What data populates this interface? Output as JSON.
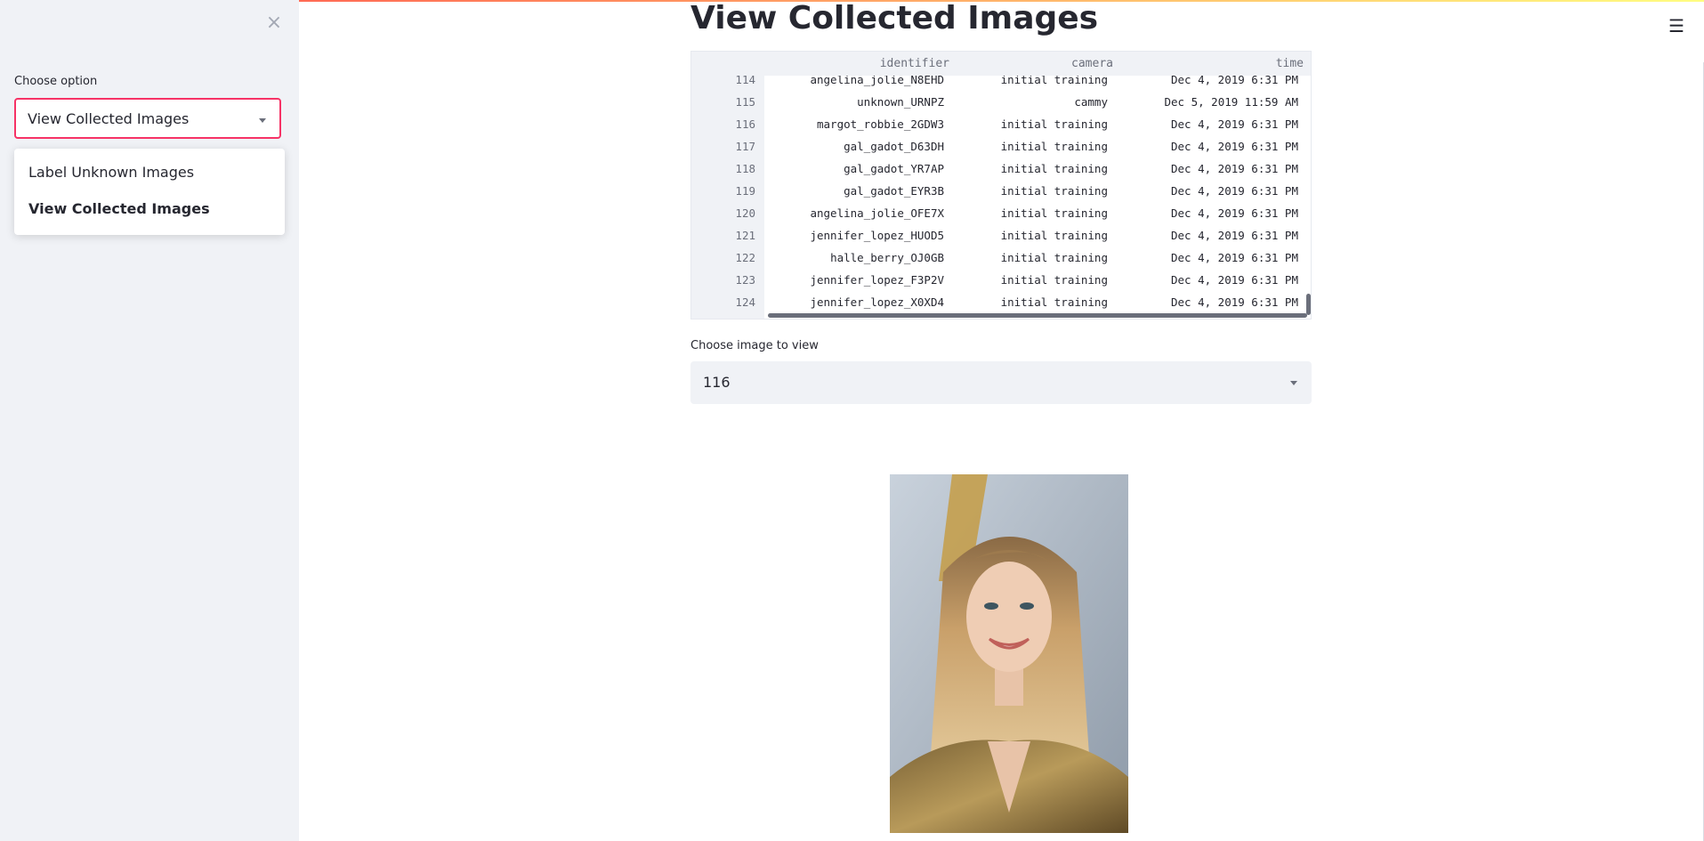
{
  "sidebar": {
    "close_glyph": "×",
    "choose_label": "Choose option",
    "selected": "View Collected Images",
    "options": [
      "Label Unknown Images",
      "View Collected Images"
    ]
  },
  "header": {
    "menu_glyph": "☰"
  },
  "main": {
    "title": "View Collected Images",
    "table": {
      "columns": [
        "identifier",
        "camera",
        "time"
      ],
      "rows": [
        {
          "index": "114",
          "identifier": "angelina_jolie_N8EHD",
          "camera": "initial training",
          "time": "Dec 4, 2019 6:31 PM"
        },
        {
          "index": "115",
          "identifier": "unknown_URNPZ",
          "camera": "cammy",
          "time": "Dec 5, 2019 11:59 AM"
        },
        {
          "index": "116",
          "identifier": "margot_robbie_2GDW3",
          "camera": "initial training",
          "time": "Dec 4, 2019 6:31 PM"
        },
        {
          "index": "117",
          "identifier": "gal_gadot_D63DH",
          "camera": "initial training",
          "time": "Dec 4, 2019 6:31 PM"
        },
        {
          "index": "118",
          "identifier": "gal_gadot_YR7AP",
          "camera": "initial training",
          "time": "Dec 4, 2019 6:31 PM"
        },
        {
          "index": "119",
          "identifier": "gal_gadot_EYR3B",
          "camera": "initial training",
          "time": "Dec 4, 2019 6:31 PM"
        },
        {
          "index": "120",
          "identifier": "angelina_jolie_OFE7X",
          "camera": "initial training",
          "time": "Dec 4, 2019 6:31 PM"
        },
        {
          "index": "121",
          "identifier": "jennifer_lopez_HUOD5",
          "camera": "initial training",
          "time": "Dec 4, 2019 6:31 PM"
        },
        {
          "index": "122",
          "identifier": "halle_berry_OJ0GB",
          "camera": "initial training",
          "time": "Dec 4, 2019 6:31 PM"
        },
        {
          "index": "123",
          "identifier": "jennifer_lopez_F3P2V",
          "camera": "initial training",
          "time": "Dec 4, 2019 6:31 PM"
        },
        {
          "index": "124",
          "identifier": "jennifer_lopez_X0XD4",
          "camera": "initial training",
          "time": "Dec 4, 2019 6:31 PM"
        }
      ]
    },
    "image_select": {
      "label": "Choose image to view",
      "value": "116"
    }
  },
  "colors": {
    "accent": "#f63366",
    "sidebar_bg": "#f0f2f6",
    "text": "#262730"
  },
  "icons": [
    "close-icon",
    "hamburger-menu-icon",
    "chevron-down-icon"
  ]
}
